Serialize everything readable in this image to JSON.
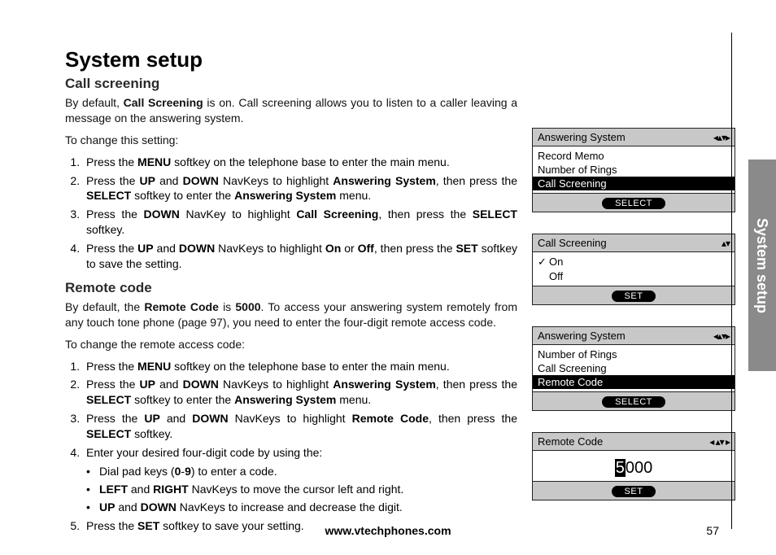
{
  "title": "System setup",
  "side_tab": "System setup",
  "footer_url": "www.vtechphones.com",
  "page_number": "57",
  "section1": {
    "heading": "Call screening",
    "intro_parts": [
      "By default, ",
      "Call Screening",
      " is on. Call screening allows you to listen to a caller leaving a message on the answering system."
    ],
    "lead": "To change this setting:",
    "steps": {
      "s1": [
        "Press the ",
        "MENU",
        " softkey on the telephone base to enter the main menu."
      ],
      "s2": [
        "Press the ",
        "UP",
        " and ",
        "DOWN",
        " NavKeys to highlight ",
        "Answering System",
        ", then press the ",
        "SELECT",
        " softkey to enter the ",
        "Answering System",
        " menu."
      ],
      "s3": [
        "Press the ",
        "DOWN",
        " NavKey to highlight ",
        "Call Screening",
        ", then press the ",
        "SELECT",
        " softkey."
      ],
      "s4": [
        "Press the ",
        "UP",
        " and ",
        "DOWN",
        " NavKeys to highlight ",
        "On",
        " or ",
        "Off",
        ", then press the ",
        "SET",
        " softkey to save the setting."
      ]
    }
  },
  "section2": {
    "heading": "Remote code",
    "intro_parts": [
      "By default, the ",
      "Remote Code",
      " is ",
      "5000",
      ". To access your answering system remotely from any touch tone phone (page 97), you need to enter the four-digit remote access code."
    ],
    "lead": "To change the remote access code:",
    "steps": {
      "s1": [
        "Press the ",
        "MENU",
        " softkey on the telephone base to enter the main menu."
      ],
      "s2": [
        "Press the ",
        "UP",
        " and ",
        "DOWN",
        " NavKeys to highlight ",
        "Answering System",
        ", then press the ",
        "SELECT",
        " softkey to enter the ",
        "Answering System",
        " menu."
      ],
      "s3": [
        "Press the ",
        "UP",
        " and ",
        "DOWN",
        " NavKeys to highlight ",
        "Remote Code",
        ", then press the ",
        "SELECT",
        " softkey."
      ],
      "s4_lead": "Enter your desired four-digit code by using the:",
      "s4_bullets": {
        "b1": [
          "Dial pad keys (",
          "0",
          "-",
          "9",
          ") to enter a code."
        ],
        "b2": [
          "LEFT",
          " and ",
          "RIGHT",
          " NavKeys to move the cursor left and right."
        ],
        "b3": [
          "UP",
          " and ",
          "DOWN",
          " NavKeys to increase and decrease the digit."
        ]
      },
      "s5": [
        "Press the ",
        "SET",
        " softkey to save your setting."
      ]
    }
  },
  "screens": {
    "s1": {
      "title": "Answering System",
      "nav": "◂▴▾▸",
      "rows": {
        "r1": "Record Memo",
        "r2": "Number of Rings",
        "r3": "Call Screening"
      },
      "button": "SELECT"
    },
    "s2": {
      "title": "Call Screening",
      "nav": "▴▾",
      "rows": {
        "r1_check": "✓",
        "r1": "On",
        "r2": "Off"
      },
      "button": "SET"
    },
    "s3": {
      "title": "Answering System",
      "nav": "◂▴▾▸",
      "rows": {
        "r1": "Number of Rings",
        "r2": "Call Screening",
        "r3": "Remote Code"
      },
      "button": "SELECT"
    },
    "s4": {
      "title": "Remote Code",
      "nav": "◂ ▴▾ ▸",
      "digit_hl": "5",
      "digit_rest": "000",
      "button": "SET"
    }
  }
}
